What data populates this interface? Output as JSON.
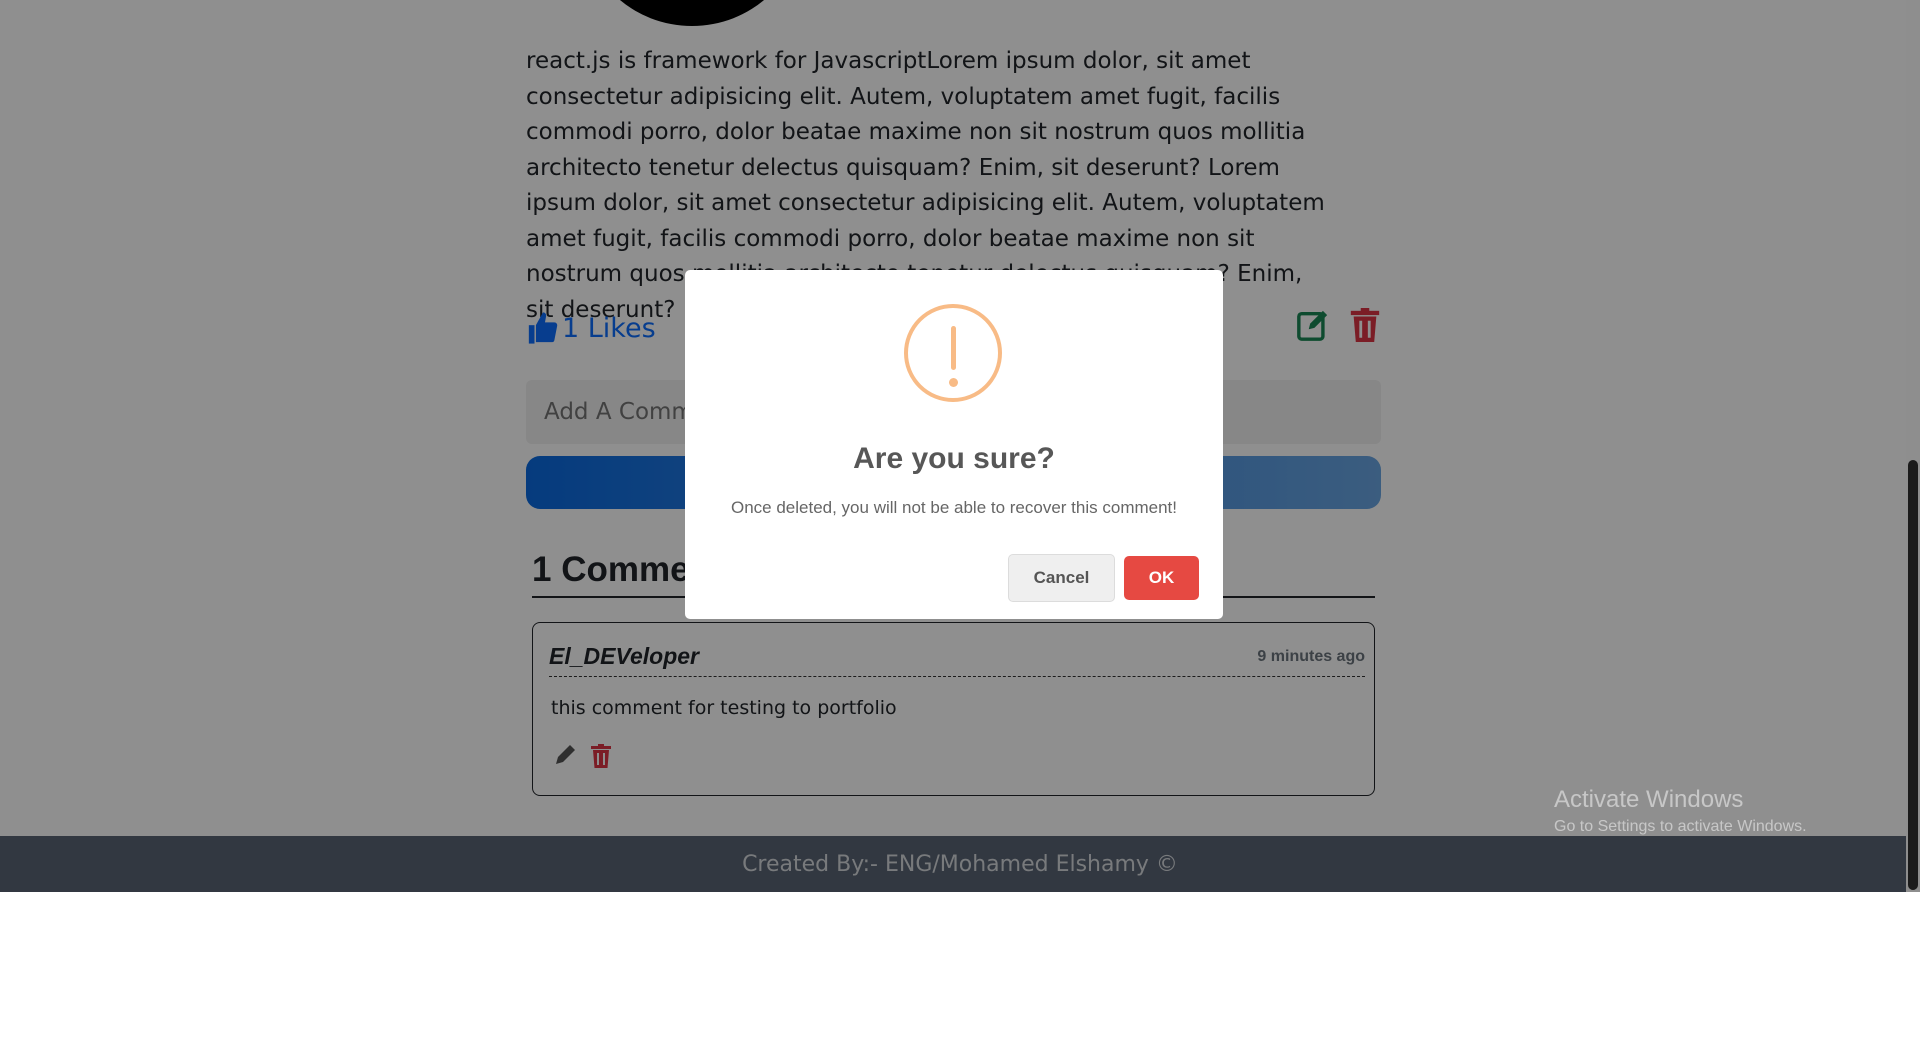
{
  "post": {
    "body": "react.js is framework for JavascriptLorem ipsum dolor, sit amet consectetur adipisicing elit. Autem, voluptatem amet fugit, facilis commodi porro, dolor beatae maxime non sit nostrum quos mollitia architecto tenetur delectus quisquam? Enim, sit deserunt? Lorem ipsum dolor, sit amet consectetur adipisicing elit. Autem, voluptatem amet fugit, facilis commodi porro, dolor beatae maxime non sit nostrum quos mollitia architecto tenetur delectus quisquam? Enim, sit deserunt?",
    "likes_label": "1 Likes",
    "like_icon": "thumbs-up-icon",
    "edit_icon": "edit-icon",
    "delete_icon": "trash-icon"
  },
  "comment_form": {
    "placeholder": "Add A Comment"
  },
  "comments": {
    "title": "1 Comments",
    "items": [
      {
        "author": "El_DEVeloper",
        "time": "9 minutes ago",
        "text": "this comment for testing to portfolio"
      }
    ]
  },
  "footer": {
    "text": "Created By:- ENG/Mohamed Elshamy ©"
  },
  "watermark": {
    "title": "Activate Windows",
    "subtitle": "Go to Settings to activate Windows."
  },
  "modal": {
    "icon": "warning-icon",
    "title": "Are you sure?",
    "text": "Once deleted, you will not be able to recover this comment!",
    "cancel_label": "Cancel",
    "ok_label": "OK"
  },
  "colors": {
    "accent": "#0d6efd",
    "danger": "#e64942",
    "warning": "#f8bb86",
    "edit": "#198754",
    "footer_bg": "#5a6575"
  }
}
